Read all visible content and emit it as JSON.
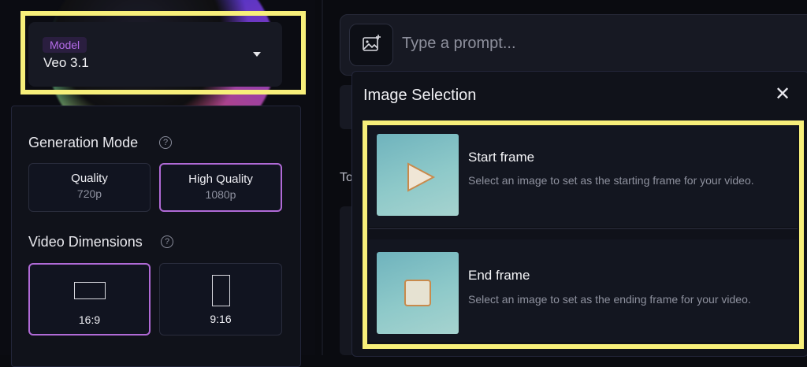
{
  "model": {
    "tag": "Model",
    "value": "Veo 3.1"
  },
  "generation_mode": {
    "title": "Generation Mode",
    "options": [
      {
        "label": "Quality",
        "sub": "720p",
        "selected": false
      },
      {
        "label": "High Quality",
        "sub": "1080p",
        "selected": true
      }
    ]
  },
  "video_dimensions": {
    "title": "Video Dimensions",
    "options": [
      {
        "label": "16:9",
        "selected": true
      },
      {
        "label": "9:16",
        "selected": false
      }
    ]
  },
  "prompt": {
    "placeholder": "Type a prompt..."
  },
  "ghost_text": "To",
  "image_selection": {
    "title": "Image Selection",
    "frames": [
      {
        "title": "Start frame",
        "desc": "Select an image to set as the starting frame for your video."
      },
      {
        "title": "End frame",
        "desc": "Select an image to set as the ending frame for your video."
      }
    ]
  },
  "colors": {
    "accent": "#b06ad6",
    "highlight": "#f7ef7a",
    "background": "#0a0b10"
  },
  "icons": {
    "help": "?",
    "close": "✕"
  }
}
